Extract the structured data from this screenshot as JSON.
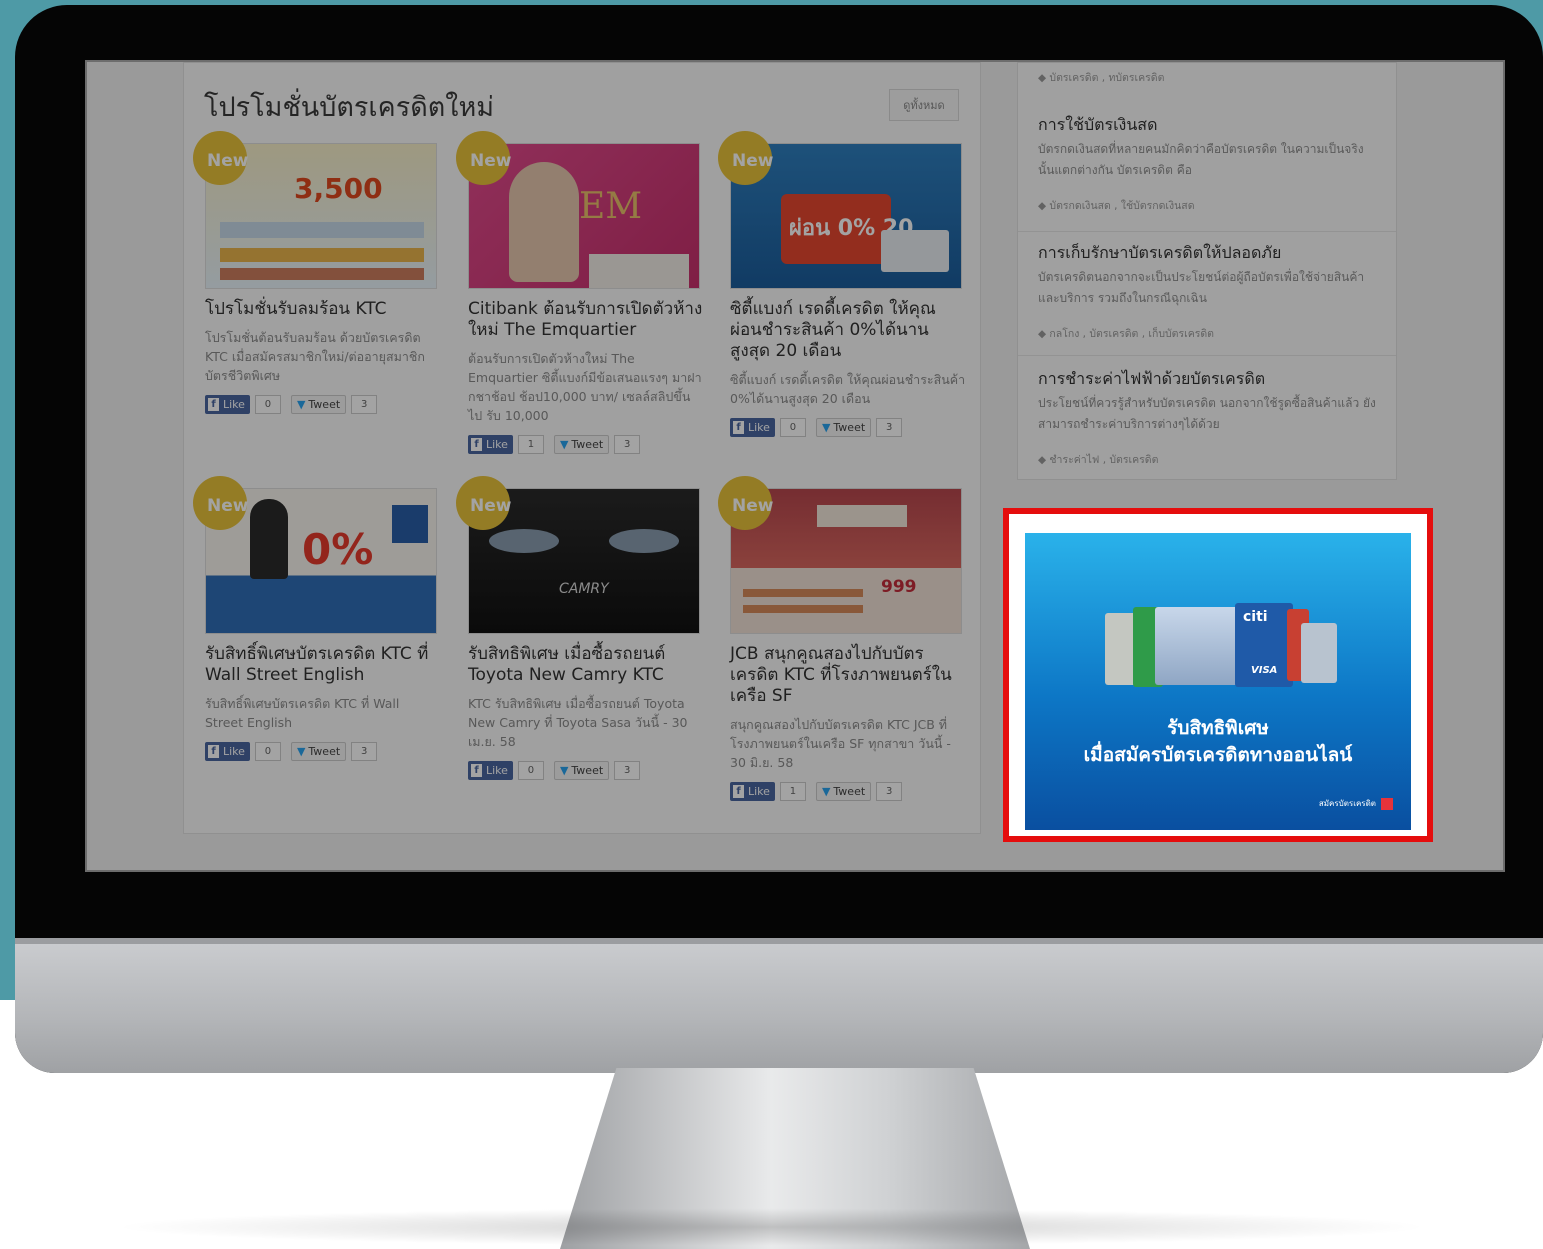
{
  "main": {
    "section_title": "โปรโมชั่นบัตรเครดิตใหม่",
    "see_all_label": "ดูทั้งหมด",
    "badge_label": "New",
    "cards": [
      {
        "title": "โปรโมชั่นรับลมร้อน KTC",
        "desc": "โปรโมชั่นต้อนรับลมร้อน ด้วยบัตรเครดิต KTC เมื่อสมัครสมาชิกใหม่/ต่ออายุสมาชิกบัตรชีวิตพิเศษ",
        "like_label": "Like",
        "like_count": "0",
        "tweet_label": "Tweet",
        "tweet_count": "3",
        "thumb_text": "3,500"
      },
      {
        "title": "Citibank ต้อนรับการเปิดตัวห้างใหม่ The Emquartier",
        "desc": "ต้อนรับการเปิดตัวห้างใหม่ The Emquartier ซิตี้แบงก์มีข้อเสนอแรงๆ มาฝากชาช้อป ช้อป10,000 บาท/ เซลล์สลิปขึ้นไป รับ 10,000",
        "like_label": "Like",
        "like_count": "1",
        "tweet_label": "Tweet",
        "tweet_count": "3",
        "thumb_text": "EM"
      },
      {
        "title": "ซิตี้แบงก์ เรดดี้เครดิต ให้คุณผ่อนชำระสินค้า 0%ได้นานสูงสุด 20 เดือน",
        "desc": "ซิตี้แบงก์ เรดดี้เครดิต ให้คุณผ่อนชำระสินค้า 0%ได้นานสูงสุด 20 เดือน",
        "like_label": "Like",
        "like_count": "0",
        "tweet_label": "Tweet",
        "tweet_count": "3",
        "thumb_text": "ผ่อน 0% 20"
      },
      {
        "title": "รับสิทธิ์พิเศษบัตรเครดิต KTC ที่ Wall Street English",
        "desc": "รับสิทธิ์พิเศษบัตรเครดิต KTC ที่ Wall Street English",
        "like_label": "Like",
        "like_count": "0",
        "tweet_label": "Tweet",
        "tweet_count": "3",
        "thumb_text": "0%"
      },
      {
        "title": "รับสิทธิพิเศษ เมื่อซื้อรถยนต์ Toyota New Camry KTC",
        "desc": "KTC รับสิทธิพิเศษ เมื่อซื้อรถยนต์ Toyota New Camry ที่ Toyota Sasa วันนี้ - 30 เม.ย. 58",
        "like_label": "Like",
        "like_count": "0",
        "tweet_label": "Tweet",
        "tweet_count": "3",
        "thumb_text": "CAMRY"
      },
      {
        "title": "JCB สนุกคูณสองไปกับบัตรเครดิต KTC ที่โรงภาพยนตร์ในเครือ SF",
        "desc": "สนุกคูณสองไปกับบัตรเครดิต KTC JCB ที่โรงภาพยนตร์ในเครือ SF ทุกสาขา วันนี้ - 30 มิ.ย. 58",
        "like_label": "Like",
        "like_count": "1",
        "tweet_label": "Tweet",
        "tweet_count": "3",
        "thumb_text": "999"
      }
    ]
  },
  "sidebar": {
    "top_tags": "บัตรเครดิต , ทบัตรเครดิต",
    "items": [
      {
        "title": "การใช้บัตรเงินสด",
        "desc": "บัตรกดเงินสดที่หลายคนมักคิดว่าคือบัตรเครดิต ในความเป็นจริงนั้นแตกต่างกัน บัตรเครดิต คือ",
        "tags": "บัตรกดเงินสด , ใช้บัตรกดเงินสด"
      },
      {
        "title": "การเก็บรักษาบัตรเครดิตให้ปลอดภัย",
        "desc": "บัตรเครดิตนอกจากจะเป็นประโยชน์ต่อผู้ถือบัตรเพื่อใช้จ่ายสินค้าและบริการ รวมถึงในกรณีฉุกเฉิน",
        "tags": "กลโกง , บัตรเครดิต , เก็บบัตรเครดิต"
      },
      {
        "title": "การชำระค่าไฟฟ้าด้วยบัตรเครดิต",
        "desc": "ประโยชน์ที่ควรรู้สำหรับบัตรเครดิต นอกจากใช้รูดซื้อสินค้าแล้ว ยังสามารถชำระค่าบริการต่างๆได้ด้วย",
        "tags": "ชำระค่าไฟ , บัตรเครดิต"
      }
    ]
  },
  "ad": {
    "line1": "รับสิทธิพิเศษ",
    "line2": "เมื่อสมัครบัตรเครดิตทางออนไลน์",
    "brand": "สมัครบัตรเครดิต",
    "card_brand_text": "citi",
    "card_network_text": "VISA",
    "highlight_color": "#e50d0d"
  }
}
